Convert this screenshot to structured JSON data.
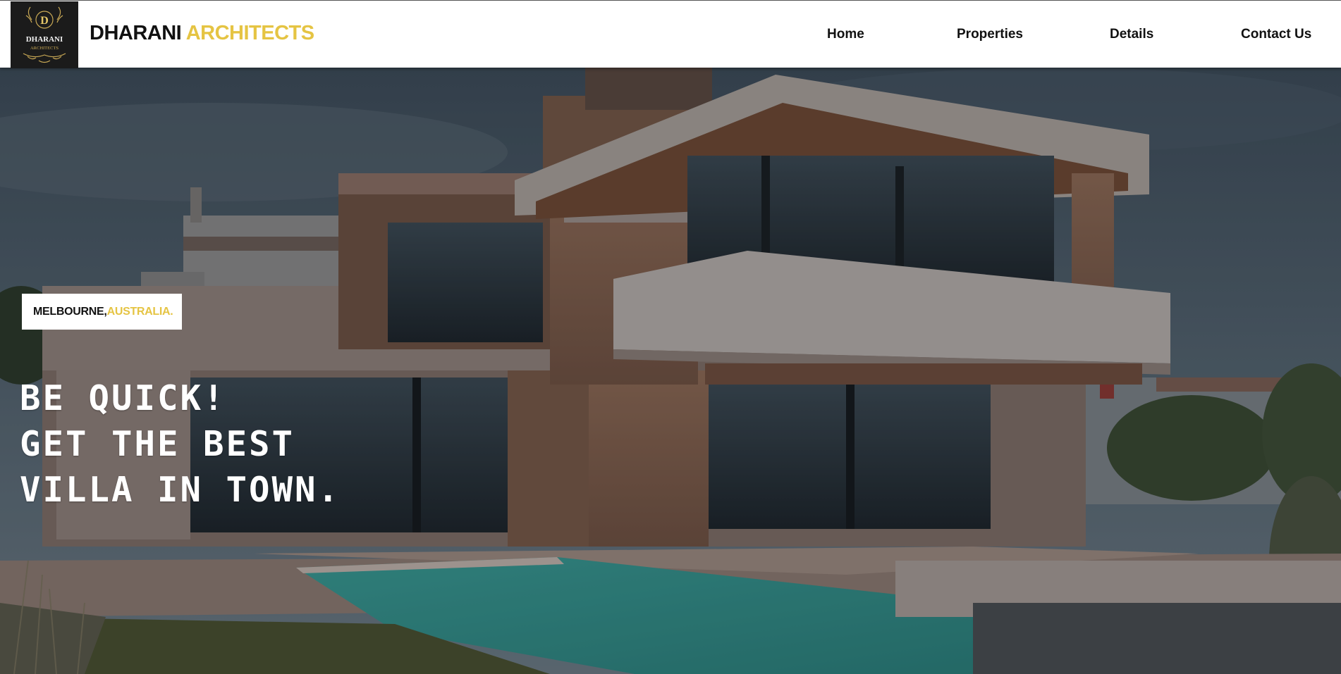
{
  "header": {
    "logo": {
      "monogram": "D",
      "name": "DHARANI",
      "sub": "ARCHITECTS"
    },
    "brand": {
      "part1": "DHARANI",
      "part2": "ARCHITECTS"
    },
    "nav": [
      {
        "label": "Home"
      },
      {
        "label": "Properties"
      },
      {
        "label": "Details"
      },
      {
        "label": "Contact Us"
      }
    ]
  },
  "hero": {
    "location": {
      "city": "MELBOURNE,",
      "country": "AUSTRALIA."
    },
    "headline": [
      "BE QUICK!",
      "GET THE BEST",
      "VILLA IN TOWN."
    ]
  },
  "colors": {
    "accent": "#e5c443",
    "header_bg": "#ffffff",
    "logo_bg": "#1b1b1b",
    "text_dark": "#111111"
  }
}
